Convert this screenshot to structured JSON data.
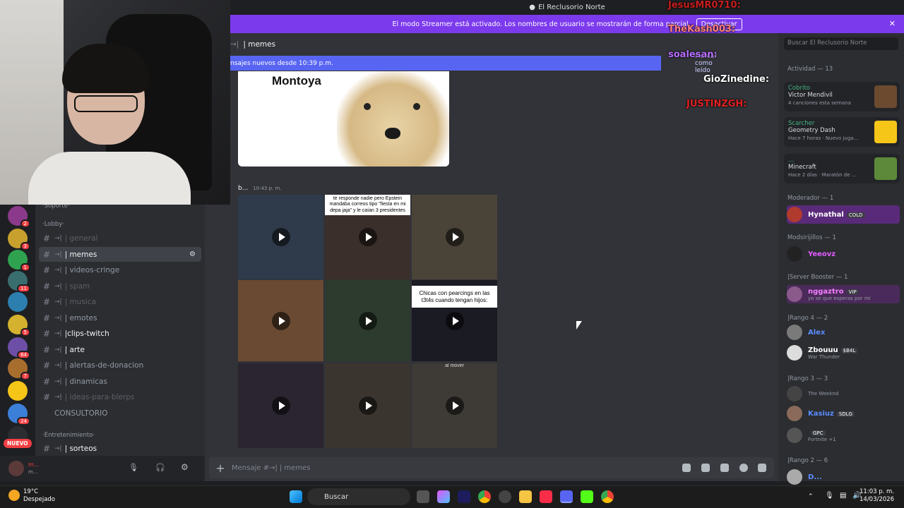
{
  "window": {
    "title": "El Reclusorio Norte"
  },
  "streamer_banner": {
    "text": "El modo Streamer está activado. Los nombres de usuario se mostrarán de forma parcial.",
    "button": "Desactivar"
  },
  "overlay_chat": [
    {
      "name": "JesusMR0710:",
      "color": "#c81e1e"
    },
    {
      "name": "TheKash003:",
      "color": "#ff7f7f"
    },
    {
      "name": "soalesan:",
      "color": "#b66dff"
    },
    {
      "name": "GioZinedine:",
      "color": "#ffffff"
    },
    {
      "name": "JUSTINZGH:",
      "color": "#e02020"
    }
  ],
  "channel_header": {
    "name": "| memes",
    "prefix": "→| "
  },
  "new_messages": {
    "text": "nsajes nuevos desde 10:39 p.m.",
    "mark_read": "Marcar como leído"
  },
  "meme": {
    "title": "Montoya"
  },
  "message": {
    "author": "b...",
    "time": "10:43 p. m."
  },
  "videos": [
    {
      "caption": ""
    },
    {
      "caption": "te responde nadie pero Epstein mandaba correos tipo \"fiesta en mi depa jaja\" y le caían 3 presidentes"
    },
    {
      "caption": ""
    },
    {
      "caption": ""
    },
    {
      "caption": ""
    },
    {
      "caption": "Chicas con pearcings en las t3t4s cuando tengan hijos:"
    },
    {
      "caption": ""
    },
    {
      "caption": ""
    },
    {
      "caption": "al mover"
    }
  ],
  "sidebar": {
    "categories": [
      {
        "label": "·Soporte·"
      },
      {
        "label": "·Lobby·"
      },
      {
        "label": "·Entretenimiento·"
      }
    ],
    "channels": [
      {
        "label": "| general",
        "state": "dim"
      },
      {
        "label": "| memes",
        "state": "active"
      },
      {
        "label": "| videos-cringe",
        "state": "normal"
      },
      {
        "label": "| spam",
        "state": "dim"
      },
      {
        "label": "| musica",
        "state": "dim"
      },
      {
        "label": "| emotes",
        "state": "normal"
      },
      {
        "label": "|clips-twitch",
        "state": "bright"
      },
      {
        "label": "| arte",
        "state": "bright"
      },
      {
        "label": "| alertas-de-donacion",
        "state": "normal"
      },
      {
        "label": "| dinamicas",
        "state": "normal"
      },
      {
        "label": "| ideas-para-blerps",
        "state": "dim"
      },
      {
        "label": "| sorteos",
        "state": "bright"
      }
    ],
    "consultorio": "CONSULTORIO",
    "nuevo": "NUEVO",
    "server_badges": [
      "2",
      "3",
      "1",
      "11",
      "5",
      "64",
      "7",
      "24"
    ]
  },
  "user_panel": {
    "name": "m...",
    "status": "m..."
  },
  "composer": {
    "placeholder": "Mensaje #→| | memes"
  },
  "right": {
    "search_placeholder": "Buscar El Reclusorio Norte",
    "activity_label": "Actividad — 13",
    "activities": [
      {
        "name": "Cobrito",
        "detail": "Victor Mendivil",
        "sub": "4 canciones esta semana"
      },
      {
        "name": "Scarcher",
        "detail": "Geometry Dash",
        "sub": "Hace 7 horas · Nuevo juga..."
      },
      {
        "name": "...",
        "detail": "Minecraft",
        "sub": "Hace 2 días · Maratón de ..."
      }
    ],
    "groups": [
      {
        "label": "Moderador — 1",
        "members": [
          {
            "name": "Hynathal",
            "tag": "COLD",
            "sub": "",
            "color": "#ffffff"
          }
        ]
      },
      {
        "label": "Modsirijillos — 1",
        "members": [
          {
            "name": "Yeeovz",
            "tag": "",
            "sub": "",
            "color": "#e25bff"
          }
        ]
      },
      {
        "label": "|Server Booster — 1",
        "members": [
          {
            "name": "nggaztro",
            "tag": "VIP",
            "sub": "yo se que esperas por mi",
            "color": "#f47fff"
          }
        ]
      },
      {
        "label": "|Rango 4 — 2",
        "members": [
          {
            "name": "Alex",
            "tag": "",
            "sub": "",
            "color": "#5b8cff"
          },
          {
            "name": "Zbouuu",
            "tag": "$B4L",
            "sub": "War Thunder",
            "color": "#ffffff"
          }
        ]
      },
      {
        "label": "|Rango 3 — 3",
        "members": [
          {
            "name": "",
            "tag": "",
            "sub": "The Weeknd",
            "color": "#ffffff"
          },
          {
            "name": "Kasiuz",
            "tag": "SDLG",
            "sub": "",
            "color": "#5b8cff"
          },
          {
            "name": "",
            "tag": "GPC",
            "sub": "Fortnite +1",
            "color": "#ffffff"
          }
        ]
      },
      {
        "label": "|Rango 2 — 6",
        "members": [
          {
            "name": "D...",
            "tag": "",
            "sub": "",
            "color": "#5b8cff"
          }
        ]
      }
    ]
  },
  "taskbar": {
    "weather_temp": "19°C",
    "weather_desc": "Despejado",
    "search": "Buscar",
    "time": "11:03 p. m.",
    "date": "14/03/2026"
  }
}
